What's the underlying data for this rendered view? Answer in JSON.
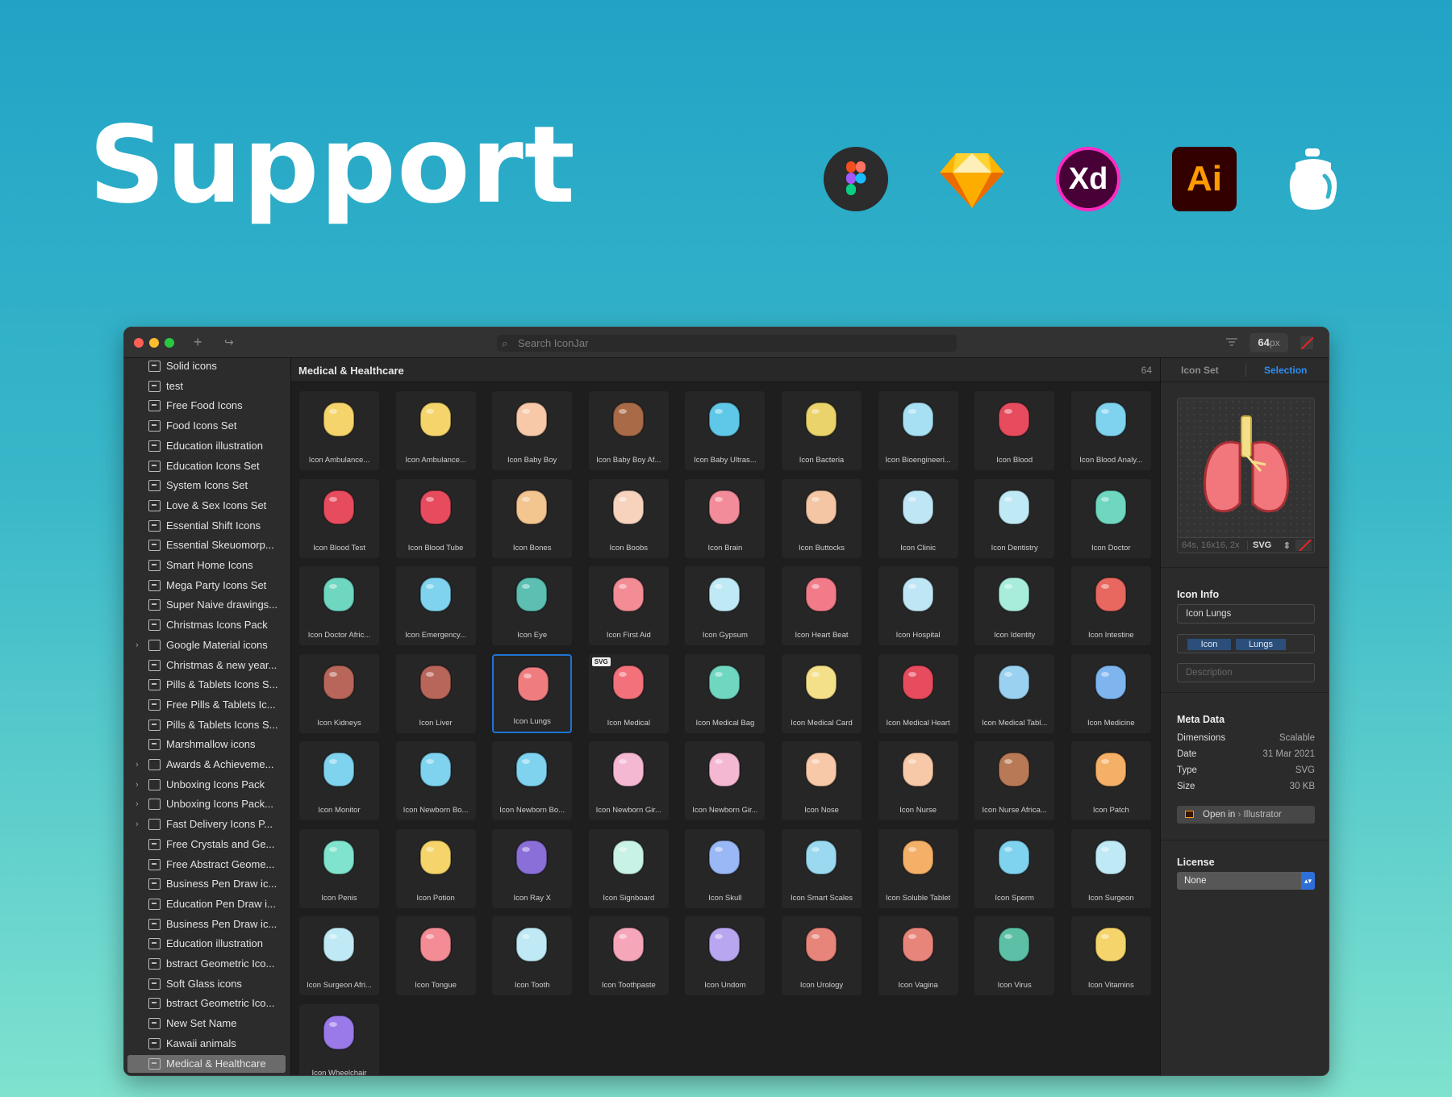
{
  "hero": {
    "title": "Support"
  },
  "logos": [
    {
      "name": "figma-logo"
    },
    {
      "name": "sketch-logo"
    },
    {
      "name": "xd-logo",
      "text": "Xd"
    },
    {
      "name": "illustrator-logo",
      "text": "Ai"
    },
    {
      "name": "iconjar-logo"
    }
  ],
  "window": {
    "search_placeholder": "Search IconJar",
    "size_value": "64",
    "size_unit": "px",
    "traffic_lights": [
      "#fe5f57",
      "#febc2e",
      "#28c840"
    ]
  },
  "sidebar": {
    "items": [
      {
        "label": "Solid icons",
        "type": "set"
      },
      {
        "label": "test",
        "type": "set"
      },
      {
        "label": "Free Food Icons",
        "type": "set"
      },
      {
        "label": "Food Icons Set",
        "type": "set"
      },
      {
        "label": "Education illustration",
        "type": "set"
      },
      {
        "label": "Education Icons Set",
        "type": "set"
      },
      {
        "label": "System Icons Set",
        "type": "set"
      },
      {
        "label": "Love & Sex Icons Set",
        "type": "set"
      },
      {
        "label": "Essential Shift Icons",
        "type": "set"
      },
      {
        "label": "Essential Skeuomorp...",
        "type": "set"
      },
      {
        "label": "Smart Home Icons",
        "type": "set"
      },
      {
        "label": "Mega Party Icons Set",
        "type": "set"
      },
      {
        "label": "Super Naive drawings...",
        "type": "set"
      },
      {
        "label": "Christmas Icons Pack",
        "type": "set"
      },
      {
        "label": "Google Material icons",
        "type": "folder"
      },
      {
        "label": "Christmas & new year...",
        "type": "set"
      },
      {
        "label": "Pills & Tablets Icons S...",
        "type": "set"
      },
      {
        "label": "Free Pills & Tablets Ic...",
        "type": "set"
      },
      {
        "label": "Pills & Tablets Icons S...",
        "type": "set"
      },
      {
        "label": "Marshmallow icons",
        "type": "set"
      },
      {
        "label": "Awards & Achieveme...",
        "type": "folder"
      },
      {
        "label": "Unboxing Icons Pack",
        "type": "folder"
      },
      {
        "label": "Unboxing Icons Pack...",
        "type": "folder"
      },
      {
        "label": "Fast Delivery Icons P...",
        "type": "folder"
      },
      {
        "label": "Free Crystals and Ge...",
        "type": "set"
      },
      {
        "label": "Free Abstract Geome...",
        "type": "set"
      },
      {
        "label": "Business Pen Draw ic...",
        "type": "set"
      },
      {
        "label": "Education Pen Draw i...",
        "type": "set"
      },
      {
        "label": "Business Pen Draw ic...",
        "type": "set"
      },
      {
        "label": "Education illustration",
        "type": "set"
      },
      {
        "label": "bstract Geometric Ico...",
        "type": "set"
      },
      {
        "label": "Soft Glass icons",
        "type": "set"
      },
      {
        "label": "bstract Geometric Ico...",
        "type": "set"
      },
      {
        "label": "New Set Name",
        "type": "set"
      },
      {
        "label": "Kawaii animals",
        "type": "set"
      },
      {
        "label": "Medical & Healthcare",
        "type": "set",
        "selected": true
      }
    ]
  },
  "main": {
    "title": "Medical & Healthcare",
    "count": "64",
    "selected_index": 29,
    "svg_badge": {
      "index": 30,
      "text": "SVG"
    },
    "icons": [
      {
        "label": "Icon Ambulance...",
        "color": "#f5d56b"
      },
      {
        "label": "Icon Ambulance...",
        "color": "#f5d56b"
      },
      {
        "label": "Icon Baby Boy",
        "color": "#f7c9a8"
      },
      {
        "label": "Icon Baby Boy Af...",
        "color": "#a86a47"
      },
      {
        "label": "Icon Baby Ultras...",
        "color": "#5fc8e8"
      },
      {
        "label": "Icon Bacteria",
        "color": "#e9d36a"
      },
      {
        "label": "Icon Bioengineeri...",
        "color": "#a6e0f2"
      },
      {
        "label": "Icon Blood",
        "color": "#e64c5e"
      },
      {
        "label": "Icon Blood Analy...",
        "color": "#7fd3ef"
      },
      {
        "label": "Icon Blood Test",
        "color": "#e64c5e"
      },
      {
        "label": "Icon Blood Tube",
        "color": "#e64c5e"
      },
      {
        "label": "Icon Bones",
        "color": "#f3c58f"
      },
      {
        "label": "Icon Boobs",
        "color": "#f7d3bd"
      },
      {
        "label": "Icon Brain",
        "color": "#f38c9a"
      },
      {
        "label": "Icon Buttocks",
        "color": "#f5c6a3"
      },
      {
        "label": "Icon Clinic",
        "color": "#bfe6f5"
      },
      {
        "label": "Icon Dentistry",
        "color": "#bfe9f5"
      },
      {
        "label": "Icon Doctor",
        "color": "#6fd6c0"
      },
      {
        "label": "Icon Doctor Afric...",
        "color": "#6fd6c0"
      },
      {
        "label": "Icon Emergency...",
        "color": "#7fd3ef"
      },
      {
        "label": "Icon Eye",
        "color": "#5cbfb2"
      },
      {
        "label": "Icon First Aid",
        "color": "#f38c95"
      },
      {
        "label": "Icon Gypsum",
        "color": "#bfe9f5"
      },
      {
        "label": "Icon Heart Beat",
        "color": "#f27b8a"
      },
      {
        "label": "Icon Hospital",
        "color": "#bfe6f5"
      },
      {
        "label": "Icon Identity",
        "color": "#a8eddc"
      },
      {
        "label": "Icon Intestine",
        "color": "#e8675e"
      },
      {
        "label": "Icon Kidneys",
        "color": "#b8665a"
      },
      {
        "label": "Icon Liver",
        "color": "#b8665a"
      },
      {
        "label": "Icon Lungs",
        "color": "#ef7d80"
      },
      {
        "label": "Icon Medical",
        "color": "#f2717a"
      },
      {
        "label": "Icon Medical Bag",
        "color": "#6fd6c0"
      },
      {
        "label": "Icon Medical Card",
        "color": "#f5e08a"
      },
      {
        "label": "Icon Medical Heart",
        "color": "#e64c5e"
      },
      {
        "label": "Icon Medical Tabl...",
        "color": "#9ad0f0"
      },
      {
        "label": "Icon Medicine",
        "color": "#7fb5ef"
      },
      {
        "label": "Icon Monitor",
        "color": "#7fd3ef"
      },
      {
        "label": "Icon Newborn Bo...",
        "color": "#7fd3ef"
      },
      {
        "label": "Icon Newborn Bo...",
        "color": "#7fd3ef"
      },
      {
        "label": "Icon Newborn Gir...",
        "color": "#f5b8d3"
      },
      {
        "label": "Icon Newborn Gir...",
        "color": "#f5b8d3"
      },
      {
        "label": "Icon Nose",
        "color": "#f7c9a8"
      },
      {
        "label": "Icon Nurse",
        "color": "#f7c9a8"
      },
      {
        "label": "Icon Nurse Africa...",
        "color": "#b87a56"
      },
      {
        "label": "Icon Patch",
        "color": "#f5b067"
      },
      {
        "label": "Icon Penis",
        "color": "#7fe3cd"
      },
      {
        "label": "Icon Potion",
        "color": "#f5d56b"
      },
      {
        "label": "Icon Ray X",
        "color": "#8a6fd8"
      },
      {
        "label": "Icon Signboard",
        "color": "#c9f2e6"
      },
      {
        "label": "Icon Skull",
        "color": "#9ab8f5"
      },
      {
        "label": "Icon Smart Scales",
        "color": "#9ad9ef"
      },
      {
        "label": "Icon Soluble Tablet",
        "color": "#f5b067"
      },
      {
        "label": "Icon Sperm",
        "color": "#7fd3ef"
      },
      {
        "label": "Icon Surgeon",
        "color": "#bfe9f5"
      },
      {
        "label": "Icon Surgeon Afri...",
        "color": "#bfe9f5"
      },
      {
        "label": "Icon Tongue",
        "color": "#f38c95"
      },
      {
        "label": "Icon Tooth",
        "color": "#bfe9f5"
      },
      {
        "label": "Icon Toothpaste",
        "color": "#f5a6b8"
      },
      {
        "label": "Icon Undom",
        "color": "#b9a6f0"
      },
      {
        "label": "Icon Urology",
        "color": "#e8857a"
      },
      {
        "label": "Icon Vagina",
        "color": "#e8857a"
      },
      {
        "label": "Icon Virus",
        "color": "#5cbfa6"
      },
      {
        "label": "Icon Vitamins",
        "color": "#f5d56b"
      },
      {
        "label": "Icon Wheelchair",
        "color": "#9a7ae8"
      }
    ]
  },
  "inspector": {
    "tabs": {
      "icon_set": "Icon Set",
      "selection": "Selection"
    },
    "preview_info": "64s, 16x16, 2x",
    "format": "SVG",
    "icon_info_heading": "Icon Info",
    "name": "Icon Lungs",
    "tags": [
      "Icon",
      "Lungs"
    ],
    "description_placeholder": "Description",
    "meta_heading": "Meta Data",
    "meta": [
      {
        "key": "Dimensions",
        "value": "Scalable"
      },
      {
        "key": "Date",
        "value": "31 Mar 2021"
      },
      {
        "key": "Type",
        "value": "SVG"
      },
      {
        "key": "Size",
        "value": "30 KB"
      }
    ],
    "open_in": "Open in",
    "open_app": "Illustrator",
    "license_heading": "License",
    "license_value": "None",
    "accent": "#2f8ef0"
  }
}
